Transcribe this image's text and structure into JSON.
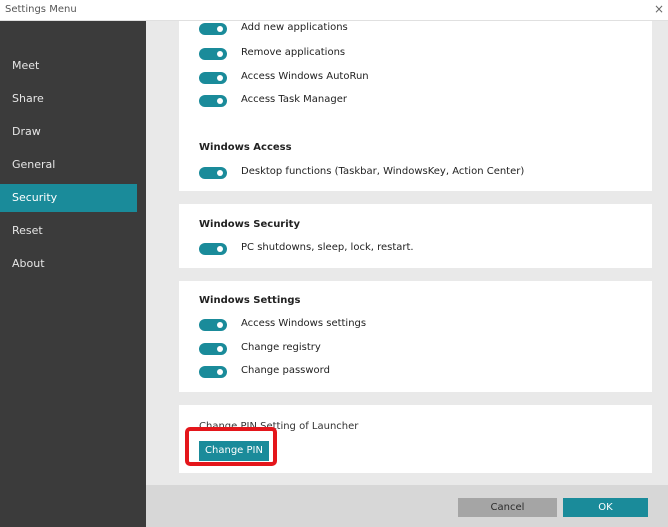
{
  "window": {
    "title": "Settings Menu",
    "close_glyph": "×"
  },
  "sidebar": {
    "items": [
      {
        "label": "Meet"
      },
      {
        "label": "Share"
      },
      {
        "label": "Draw"
      },
      {
        "label": "General"
      },
      {
        "label": "Security",
        "active": true
      },
      {
        "label": "Reset"
      },
      {
        "label": "About"
      }
    ]
  },
  "sections": {
    "applications": {
      "items": [
        {
          "label": "Add new applications",
          "enabled": true
        },
        {
          "label": "Remove applications",
          "enabled": true
        },
        {
          "label": "Access Windows AutoRun",
          "enabled": true
        },
        {
          "label": "Access Task Manager",
          "enabled": true
        }
      ]
    },
    "windows_access": {
      "title": "Windows Access",
      "items": [
        {
          "label": "Desktop functions (Taskbar, WindowsKey, Action Center)",
          "enabled": true
        }
      ]
    },
    "windows_security": {
      "title": "Windows Security",
      "items": [
        {
          "label": "PC shutdowns, sleep, lock, restart.",
          "enabled": true
        }
      ]
    },
    "windows_settings": {
      "title": "Windows Settings",
      "items": [
        {
          "label": "Access Windows settings",
          "enabled": true
        },
        {
          "label": "Change registry",
          "enabled": true
        },
        {
          "label": "Change password",
          "enabled": true
        }
      ]
    },
    "pin": {
      "label": "Change PIN Setting of Launcher",
      "button_label": "Change PIN"
    }
  },
  "footer": {
    "cancel_label": "Cancel",
    "ok_label": "OK"
  },
  "colors": {
    "accent": "#1a8b9a",
    "sidebar_bg": "#3b3b3b",
    "highlight": "#e4161b"
  }
}
